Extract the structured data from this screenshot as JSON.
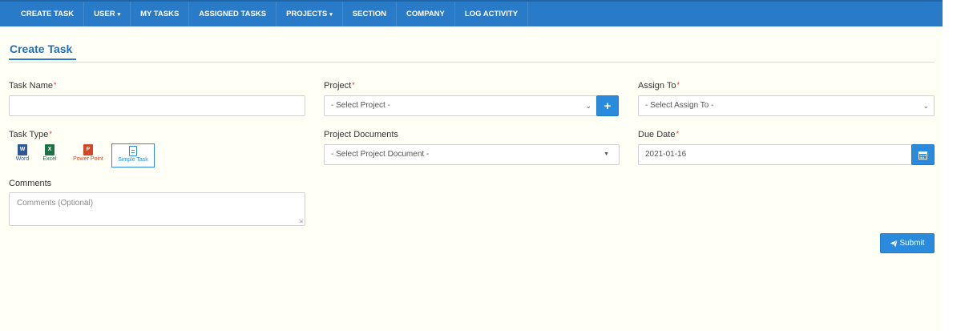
{
  "nav": {
    "items": [
      {
        "label": "CREATE TASK",
        "caret": ""
      },
      {
        "label": "USER",
        "caret": "▾"
      },
      {
        "label": "MY TASKS",
        "caret": ""
      },
      {
        "label": "ASSIGNED TASKS",
        "caret": ""
      },
      {
        "label": "PROJECTS",
        "caret": "▾"
      },
      {
        "label": "SECTION",
        "caret": ""
      },
      {
        "label": "COMPANY",
        "caret": ""
      },
      {
        "label": "LOG ACTIVITY",
        "caret": ""
      }
    ]
  },
  "page": {
    "title": "Create Task"
  },
  "form": {
    "required_mark": "*",
    "task_name": {
      "label": "Task Name",
      "value": ""
    },
    "project": {
      "label": "Project",
      "selected": "- Select Project -"
    },
    "assign_to": {
      "label": "Assign To",
      "selected": "- Select Assign To -"
    },
    "task_type": {
      "label": "Task Type",
      "options": [
        {
          "label": "Word",
          "icon": "word-icon",
          "letter": "W",
          "color": "#2b5797"
        },
        {
          "label": "Excel",
          "icon": "excel-icon",
          "letter": "X",
          "color": "#1e7145"
        },
        {
          "label": "Power Point",
          "icon": "powerpoint-icon",
          "letter": "P",
          "color": "#d24726"
        },
        {
          "label": "Simple Task",
          "icon": "document-icon",
          "letter": "",
          "color": "#2a8bdc",
          "selected": true
        }
      ]
    },
    "project_documents": {
      "label": "Project Documents",
      "selected": "- Select Project Document -"
    },
    "due_date": {
      "label": "Due Date",
      "value": "2021-01-16"
    },
    "comments": {
      "label": "Comments",
      "placeholder": "Comments (Optional)"
    },
    "submit_label": "Submit"
  },
  "colors": {
    "nav_bg": "#2a7bc7",
    "accent": "#2a8bdc",
    "page_bg": "#fffff6",
    "required": "#dd3333"
  }
}
